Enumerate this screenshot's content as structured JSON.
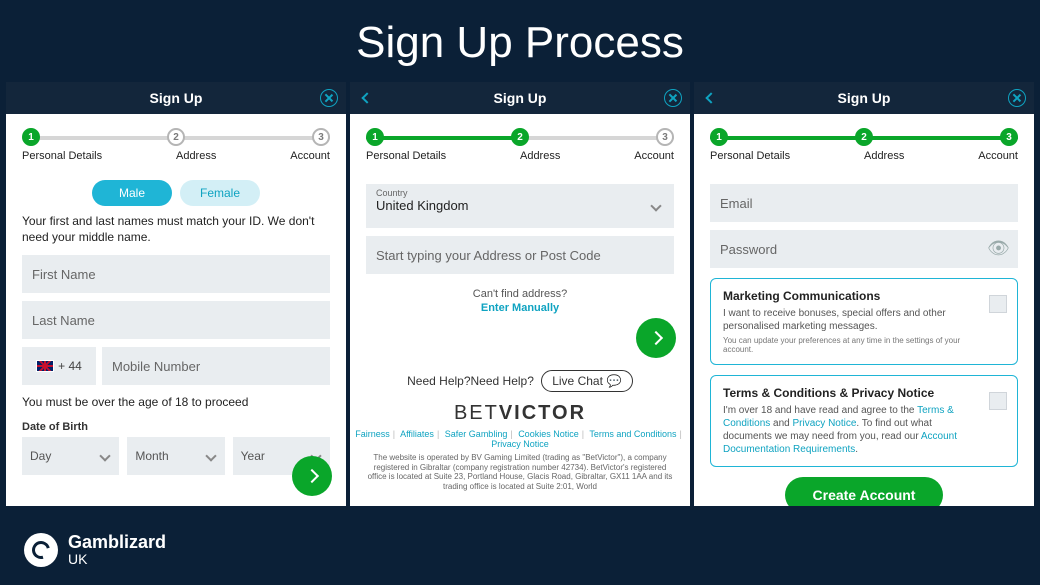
{
  "page_title": "Sign Up Process",
  "brand": {
    "name": "Gamblizard",
    "sub": "UK"
  },
  "common": {
    "header": "Sign Up",
    "steps": [
      "Personal Details",
      "Address",
      "Account"
    ]
  },
  "card1": {
    "active_step": 1,
    "gender": {
      "male": "Male",
      "female": "Female"
    },
    "name_note": "Your first and last names must match your ID. We don't need your middle name.",
    "first_name_ph": "First Name",
    "last_name_ph": "Last Name",
    "cc": "+ 44",
    "mobile_ph": "Mobile Number",
    "age_note": "You must be over the age of 18 to proceed",
    "dob_label": "Date of Birth",
    "day": "Day",
    "month": "Month",
    "year": "Year"
  },
  "card2": {
    "active_step": 2,
    "country_label": "Country",
    "country_value": "United Kingdom",
    "address_ph": "Start typing your Address or Post Code",
    "cant_find": "Can't find address?",
    "enter_manually": "Enter Manually",
    "need_help": "Need Help?Need Help?",
    "live_chat": "Live Chat",
    "brand1": "BET",
    "brand2": "VICTOR",
    "links": [
      "Fairness",
      "Affiliates",
      "Safer Gambling",
      "Cookies Notice",
      "Terms and Conditions",
      "Privacy Notice"
    ],
    "legal": "The website is operated by BV Gaming Limited (trading as \"BetVictor\"), a company registered in Gibraltar (company registration number 42734). BetVictor's registered office is located at Suite 23, Portland House, Glacis Road, Gibraltar, GX11 1AA and its trading office is located at Suite 2:01, World"
  },
  "card3": {
    "active_step": 3,
    "email_ph": "Email",
    "password_ph": "Password",
    "mkt_title": "Marketing Communications",
    "mkt_text": "I want to receive bonuses, special offers and other personalised marketing messages.",
    "mkt_sub": "You can update your preferences at any time in the settings of your account.",
    "tc_title": "Terms & Conditions & Privacy Notice",
    "tc_text_1": "I'm over 18 and have read and agree to the ",
    "tc_link_1": "Terms & Conditions",
    "tc_text_2": " and ",
    "tc_link_2": "Privacy Notice",
    "tc_text_3": ". To find out what documents we may need from you, read our ",
    "tc_link_3": "Account Documentation Requirements",
    "tc_text_4": ".",
    "create": "Create Account"
  }
}
